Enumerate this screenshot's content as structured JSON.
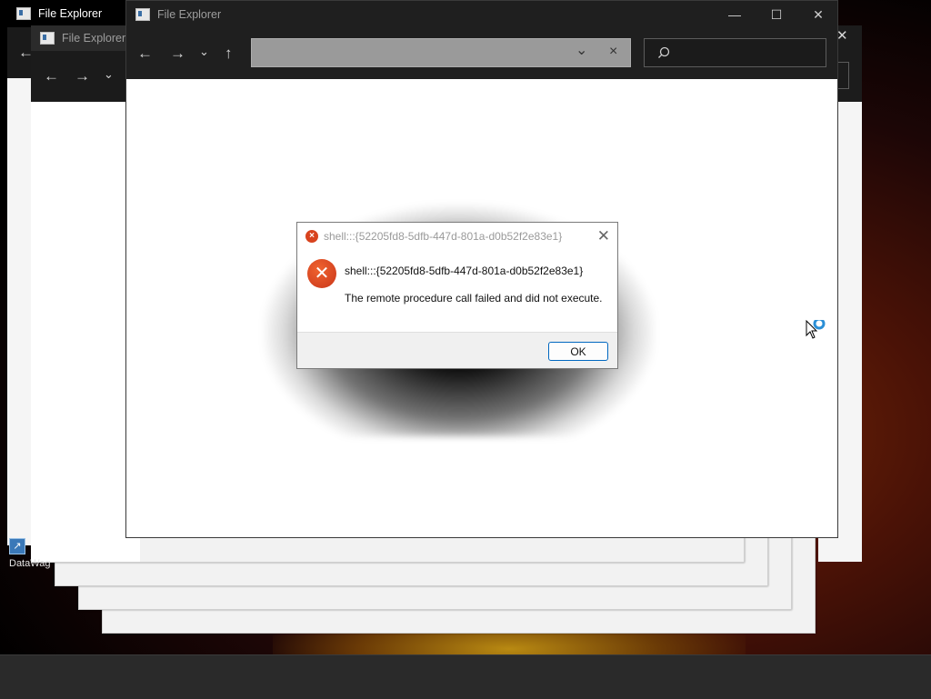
{
  "windows": {
    "back_window_title": "File Explorer",
    "middle_window_title": "File Explorer",
    "front_window_title": "File Explorer"
  },
  "icons": {
    "back": "arrow-left",
    "forward": "arrow-right",
    "recent": "chevron-down",
    "up": "arrow-up",
    "search": "magnifier",
    "minimize": "minimize",
    "maximize": "maximize",
    "close": "close",
    "error": "error-x"
  },
  "address_bar": {
    "value": "",
    "dropdown_glyph": "⌄",
    "clear_glyph": "×"
  },
  "search": {
    "placeholder": ""
  },
  "dialog": {
    "title": "shell:::{52205fd8-5dfb-447d-801a-d0b52f2e83e1}",
    "heading": "shell:::{52205fd8-5dfb-447d-801a-d0b52f2e83e1}",
    "message": "The remote procedure call failed and did not execute.",
    "ok_label": "OK"
  },
  "desktop": {
    "shortcut_label": "DataWag"
  },
  "colors": {
    "error_red": "#d8431e",
    "accent_blue": "#0067c0",
    "titlebar_dark": "#1f1f1f"
  }
}
